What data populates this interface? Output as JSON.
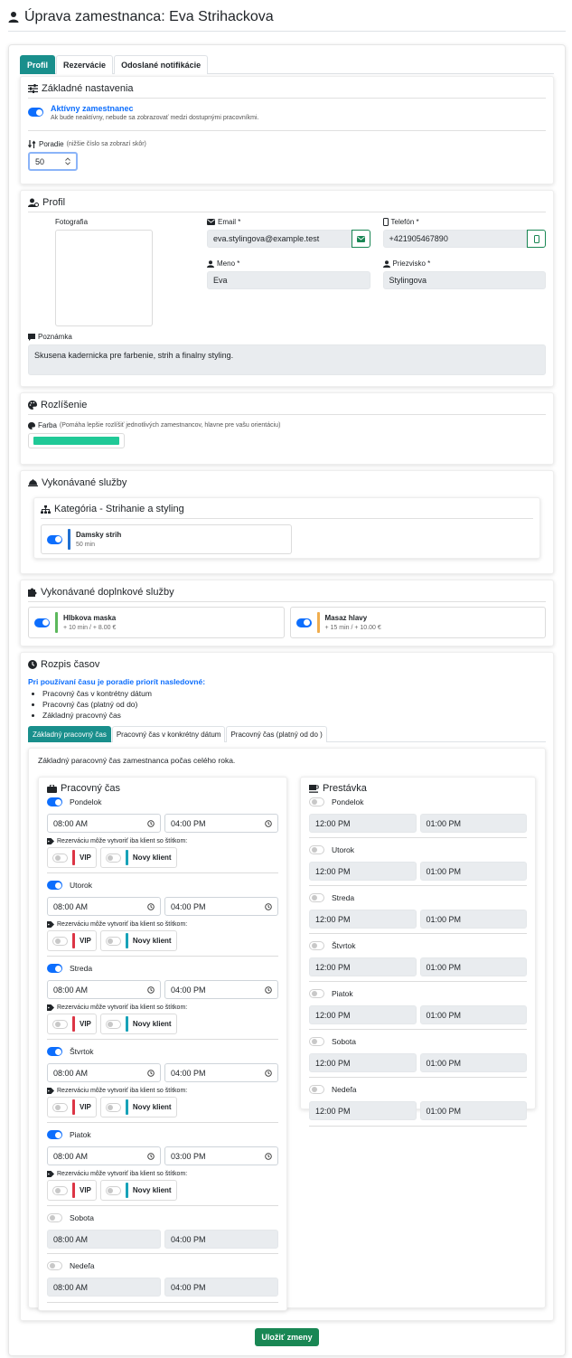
{
  "page": {
    "title": "Úprava zamestnanca: Eva Strihackova"
  },
  "tabs": [
    {
      "label": "Profil",
      "active": true
    },
    {
      "label": "Rezervácie",
      "active": false
    },
    {
      "label": "Odoslané notifikácie",
      "active": false
    }
  ],
  "basic": {
    "title": "Základné nastavenia",
    "active_label": "Aktívny zamestnanec",
    "active_help": "Ak bude neaktívny, nebude sa zobrazovať medzi dostupnými pracovníkmi.",
    "active_on": true,
    "order_label": "Poradie",
    "order_help": "(nižšie číslo sa zobrazí skôr)",
    "order_value": "50"
  },
  "profile": {
    "title": "Profil",
    "photo_label": "Fotografia",
    "email_label": "Email *",
    "email_value": "eva.stylingova@example.test",
    "phone_label": "Telefón *",
    "phone_value": "+421905467890",
    "name_label": "Meno *",
    "name_value": "Eva",
    "surname_label": "Priezvisko *",
    "surname_value": "Stylingova",
    "note_label": "Poznámka",
    "note_value": "Skusena kadernicka pre farbenie, strih a finalny styling."
  },
  "resolution": {
    "title": "Rozlíšenie",
    "color_label": "Farba",
    "color_help": "(Pomáha lepšie rozlíšiť jednotlivých zamestnancov, hlavne pre vašu orientáciu)",
    "color_value": "#20c997"
  },
  "services": {
    "title": "Vykonávané služby",
    "category_title": "Kategória - Strihanie a styling",
    "items": [
      {
        "name": "Damsky strih",
        "sub": "50 min",
        "color": "#1f6fd1",
        "on": true
      }
    ]
  },
  "addons": {
    "title": "Vykonávané doplnkové služby",
    "items": [
      {
        "name": "Hlbkova maska",
        "sub": "+ 10 min / + 8.00 €",
        "color": "#5cb85c",
        "on": true
      },
      {
        "name": "Masaz hlavy",
        "sub": "+ 15 min / + 10.00 €",
        "color": "#f0ad4e",
        "on": true
      }
    ]
  },
  "schedule": {
    "title": "Rozpis časov",
    "priority_heading": "Pri používaní času je poradie priorít nasledovné:",
    "priority_items": [
      "Pracovný čas v kontrétny dátum",
      "Pracovný čas (platný od do)",
      "Základný pracovný čas"
    ],
    "subtabs": [
      {
        "label": "Základný pracovný čas",
        "active": true
      },
      {
        "label": "Pracovný čas v konkrétny dátum",
        "active": false
      },
      {
        "label": "Pracovný čas (platný od  do  )",
        "active": false
      }
    ],
    "description": "Základný paracovný čas zamestnanca počas celého roka.",
    "work_title": "Pracovný čas",
    "break_title": "Prestávka",
    "tag_label": "Rezerváciu môže vytvoriť iba klient so štítkom:",
    "tags": [
      {
        "name": "VIP",
        "color": "#dc3545"
      },
      {
        "name": "Novy klient",
        "color": "#17a2b8"
      }
    ],
    "work_days": [
      {
        "day": "Pondelok",
        "on": true,
        "from": "08:00 AM",
        "to": "04:00 PM"
      },
      {
        "day": "Utorok",
        "on": true,
        "from": "08:00 AM",
        "to": "04:00 PM"
      },
      {
        "day": "Streda",
        "on": true,
        "from": "08:00 AM",
        "to": "04:00 PM"
      },
      {
        "day": "Štvrtok",
        "on": true,
        "from": "08:00 AM",
        "to": "04:00 PM"
      },
      {
        "day": "Piatok",
        "on": true,
        "from": "08:00 AM",
        "to": "03:00 PM"
      },
      {
        "day": "Sobota",
        "on": false,
        "from": "08:00 AM",
        "to": "04:00 PM"
      },
      {
        "day": "Nedeľa",
        "on": false,
        "from": "08:00 AM",
        "to": "04:00 PM"
      }
    ],
    "break_days": [
      {
        "day": "Pondelok",
        "on": false,
        "from": "12:00 PM",
        "to": "01:00 PM"
      },
      {
        "day": "Utorok",
        "on": false,
        "from": "12:00 PM",
        "to": "01:00 PM"
      },
      {
        "day": "Streda",
        "on": false,
        "from": "12:00 PM",
        "to": "01:00 PM"
      },
      {
        "day": "Štvrtok",
        "on": false,
        "from": "12:00 PM",
        "to": "01:00 PM"
      },
      {
        "day": "Piatok",
        "on": false,
        "from": "12:00 PM",
        "to": "01:00 PM"
      },
      {
        "day": "Sobota",
        "on": false,
        "from": "12:00 PM",
        "to": "01:00 PM"
      },
      {
        "day": "Nedeľa",
        "on": false,
        "from": "12:00 PM",
        "to": "01:00 PM"
      }
    ]
  },
  "footer": {
    "save_label": "Uložiť zmeny"
  }
}
